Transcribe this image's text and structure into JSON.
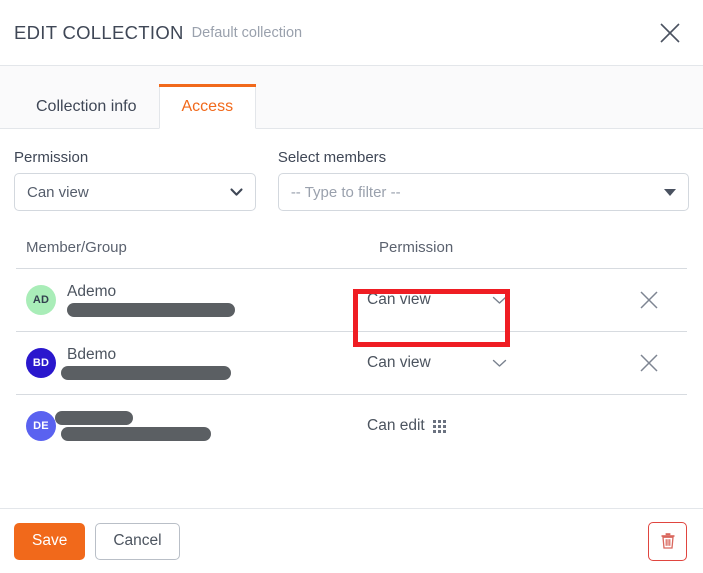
{
  "header": {
    "title": "EDIT COLLECTION",
    "subtitle": "Default collection",
    "close_icon": "close-icon"
  },
  "tabs": [
    {
      "label": "Collection info",
      "active": false
    },
    {
      "label": "Access",
      "active": true
    }
  ],
  "form": {
    "permission": {
      "label": "Permission",
      "value": "Can view"
    },
    "members": {
      "label": "Select members",
      "placeholder": "-- Type to filter --",
      "value": ""
    }
  },
  "table": {
    "columns": {
      "member": "Member/Group",
      "permission": "Permission"
    },
    "rows": [
      {
        "initials": "AD",
        "avatar_bg": "#a9edb8",
        "avatar_fg": "#33404f",
        "name": "Ademo",
        "name_redacted": false,
        "detail_redacted": true,
        "permission": "Can view",
        "permission_editable": true,
        "has_remove": true,
        "highlighted": true
      },
      {
        "initials": "BD",
        "avatar_bg": "#2a17cd",
        "avatar_fg": "#ffffff",
        "name": "Bdemo",
        "name_redacted": false,
        "detail_redacted": true,
        "permission": "Can view",
        "permission_editable": true,
        "has_remove": true,
        "highlighted": false
      },
      {
        "initials": "DE",
        "avatar_bg": "#5a62f0",
        "avatar_fg": "#ffffff",
        "name": "",
        "name_redacted": true,
        "detail_redacted": true,
        "permission": "Can edit",
        "permission_editable": false,
        "has_group_icon": true,
        "has_remove": false,
        "highlighted": false
      }
    ]
  },
  "footer": {
    "save_label": "Save",
    "cancel_label": "Cancel",
    "delete_icon": "trash-icon"
  },
  "colors": {
    "accent": "#f1691b",
    "danger": "#e0453f",
    "highlight": "#ef1d23"
  }
}
